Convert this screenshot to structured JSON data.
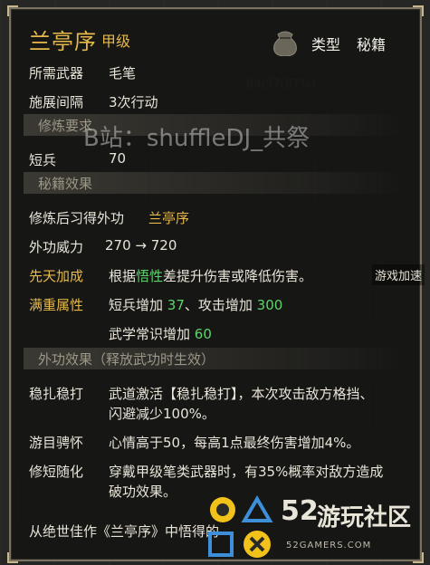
{
  "header": {
    "title": "兰亭序",
    "grade": "甲级",
    "type_label": "类型",
    "type_value": "秘籍"
  },
  "basic": [
    {
      "label": "所需武器",
      "value": "毛笔"
    },
    {
      "label": "施展间隔",
      "value": "3次行动"
    }
  ],
  "section_train": "修炼要求",
  "train_req": {
    "label": "短兵",
    "value": "70"
  },
  "section_effect": "秘籍效果",
  "learn": {
    "label": "修炼后习得外功",
    "value": "兰亭序"
  },
  "power": {
    "label": "外功威力",
    "value": "270 → 720"
  },
  "innate": {
    "label": "先天加成",
    "prefix": "根据",
    "highlight": "悟性",
    "suffix": "差提升伤害或降低伤害。"
  },
  "full": {
    "label": "满重属性",
    "t1": "短兵增加 ",
    "v1": "37",
    "t2": "、攻击增加 ",
    "v2": "300",
    "t3": "武学常识增加 ",
    "v3": "60"
  },
  "section_outer": "外功效果（释放武功时生效）",
  "effects": [
    {
      "label": "稳扎稳打",
      "line1": "武道激活【稳扎稳打】，本次攻击敌方格挡、",
      "line2": "闪避减少100%。"
    },
    {
      "label": "游目骋怀",
      "line1": "心情高于50，每高1点最终伤害增加4%。",
      "line2": ""
    },
    {
      "label": "修短随化",
      "line1": "穿戴甲级笔类武器时，有35%概率对敌方造成",
      "line2": "破功效果。"
    }
  ],
  "footer": "从绝世佳作《兰亭序》中悟得的",
  "watermark": "B站：shuffleDJ_共祭",
  "logo": {
    "num": "52",
    "cn": "游玩社区",
    "sub": "52GAMERS.COM"
  },
  "side_label": "游戏加速",
  "colors": {
    "gold": "#e6b94a",
    "green": "#5fd36b",
    "text": "#e8e4d8"
  }
}
